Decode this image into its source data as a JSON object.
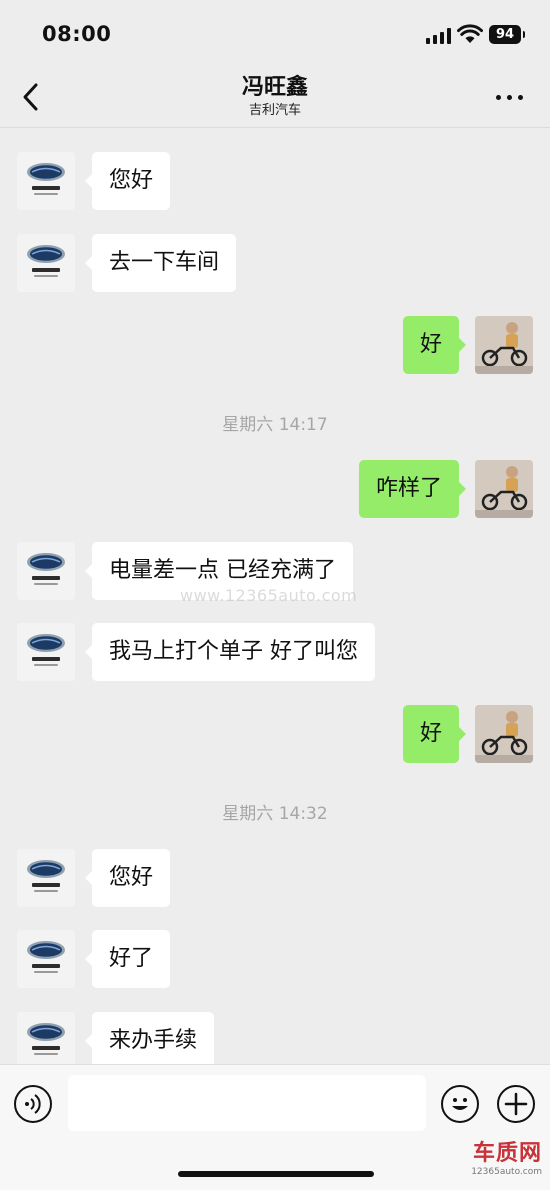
{
  "status_bar": {
    "time": "08:00",
    "battery": "94"
  },
  "header": {
    "name": "冯旺鑫",
    "subtitle": "吉利汽车"
  },
  "messages": [
    {
      "text": "您好"
    },
    {
      "text": "去一下车间"
    },
    {
      "text": "好"
    },
    {
      "text": "咋样了"
    },
    {
      "text": "电量差一点 已经充满了"
    },
    {
      "text": "我马上打个单子  好了叫您"
    },
    {
      "text": "好"
    },
    {
      "text": "您好"
    },
    {
      "text": "好了"
    },
    {
      "text": "来办手续"
    }
  ],
  "timestamps": [
    "星期六 14:17",
    "星期六 14:32"
  ],
  "watermark": "www.12365auto.com",
  "input": {
    "placeholder": ""
  },
  "logo": {
    "text": "车质网",
    "url": "12365auto.com"
  },
  "colors": {
    "background": "#ededed",
    "outgoing_bubble": "#95ec69",
    "incoming_bubble": "#ffffff",
    "timestamp": "#a6a6a6"
  },
  "icons": [
    "back-arrow-icon",
    "more-dots-icon",
    "voice-icon",
    "emoji-icon",
    "plus-icon",
    "signal-icon",
    "wifi-icon",
    "battery-icon"
  ]
}
